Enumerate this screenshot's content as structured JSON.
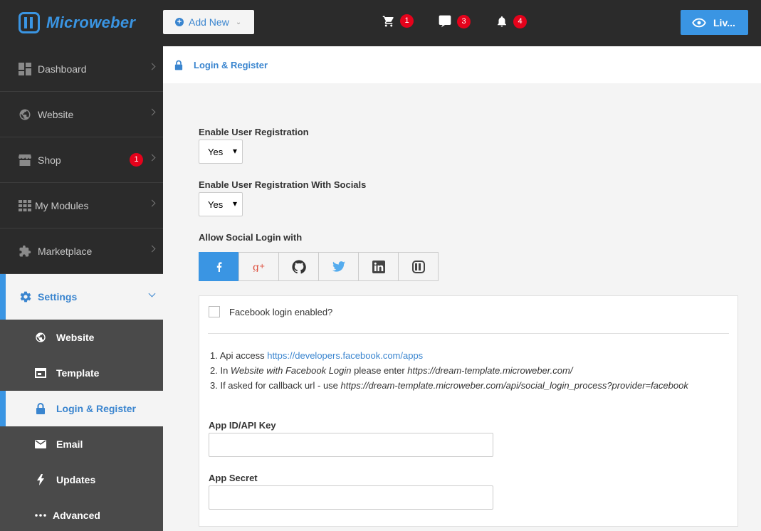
{
  "app": {
    "name": "Microweber"
  },
  "topbar": {
    "add_new_label": "Add New",
    "live_label": "Liv...",
    "notifications": [
      {
        "icon": "cart-icon",
        "count": "1"
      },
      {
        "icon": "comment-icon",
        "count": "3"
      },
      {
        "icon": "bell-icon",
        "count": "4"
      }
    ]
  },
  "sidebar": {
    "items": [
      {
        "label": "Dashboard",
        "icon": "dashboard-icon"
      },
      {
        "label": "Website",
        "icon": "globe-icon"
      },
      {
        "label": "Shop",
        "icon": "shop-icon",
        "badge": "1"
      },
      {
        "label": "My Modules",
        "icon": "modules-icon"
      },
      {
        "label": "Marketplace",
        "icon": "puzzle-icon"
      }
    ],
    "settings": {
      "label": "Settings",
      "subitems": [
        {
          "label": "Website",
          "icon": "globe-icon"
        },
        {
          "label": "Template",
          "icon": "template-icon"
        },
        {
          "label": "Login & Register",
          "icon": "lock-icon",
          "active": true
        },
        {
          "label": "Email",
          "icon": "mail-icon"
        },
        {
          "label": "Updates",
          "icon": "bolt-icon"
        },
        {
          "label": "Advanced",
          "icon": "dots-icon"
        }
      ]
    }
  },
  "main": {
    "header_title": "Login & Register",
    "enable_registration": {
      "label": "Enable User Registration",
      "value": "Yes"
    },
    "enable_socials": {
      "label": "Enable User Registration With Socials",
      "value": "Yes"
    },
    "social_login_label": "Allow Social Login with",
    "social_tabs": [
      "facebook-icon",
      "google-plus-icon",
      "github-icon",
      "twitter-icon",
      "linkedin-icon",
      "microweber-icon"
    ],
    "panel": {
      "checkbox_label": "Facebook login enabled?",
      "step1_prefix": "1. Api access ",
      "step1_link": "https://developers.facebook.com/apps",
      "step2_prefix": "2. In ",
      "step2_em1": "Website with Facebook Login",
      "step2_mid": " please enter ",
      "step2_em2": "https://dream-template.microweber.com/",
      "step3_prefix": "3. If asked for callback url - use ",
      "step3_em": "https://dream-template.microweber.com/api/social_login_process?provider=facebook",
      "app_id_label": "App ID/API Key",
      "app_secret_label": "App Secret",
      "app_id_value": "",
      "app_secret_value": ""
    }
  },
  "colors": {
    "accent": "#3a95e3",
    "sidebar_bg": "#2b2b2b",
    "badge": "#e5021b"
  }
}
